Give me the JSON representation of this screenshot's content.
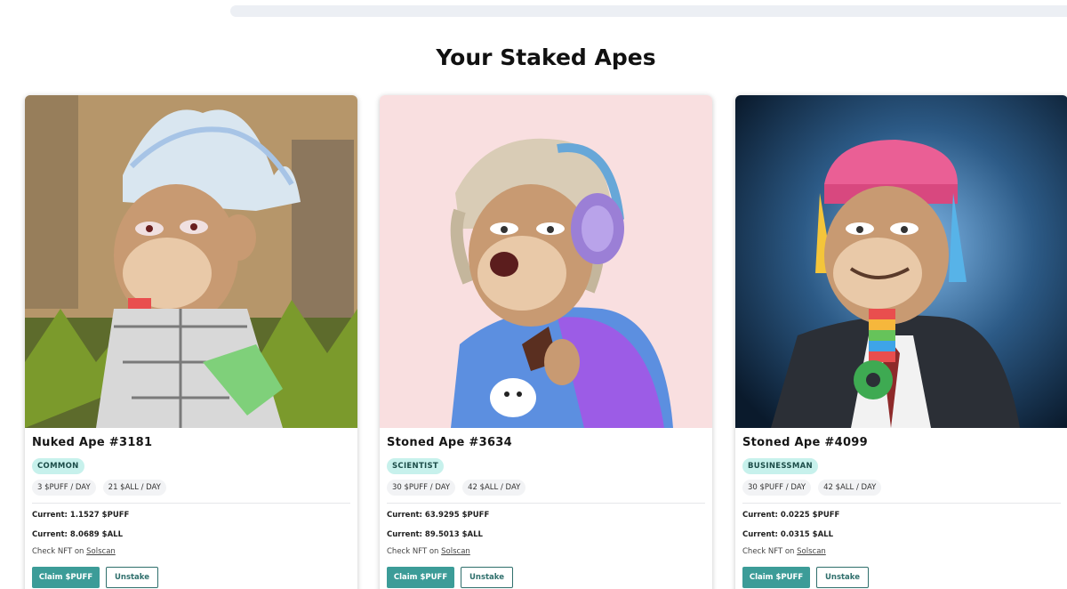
{
  "section_title": "Your Staked Apes",
  "labels": {
    "current_prefix": "Current:",
    "check_prefix": "Check NFT on",
    "check_link": "Solscan",
    "claim_button": "Claim $PUFF",
    "unstake_button": "Unstake"
  },
  "cards": [
    {
      "name": "Nuked Ape #3181",
      "trait": "COMMON",
      "rate_puff": "3 $PUFF / DAY",
      "rate_all": "21 $ALL / DAY",
      "current_puff": "Current: 1.1527 $PUFF",
      "current_all": "Current: 8.0689 $ALL",
      "background_color": "#b89a6a"
    },
    {
      "name": "Stoned Ape #3634",
      "trait": "SCIENTIST",
      "rate_puff": "30 $PUFF / DAY",
      "rate_all": "42 $ALL / DAY",
      "current_puff": "Current: 63.9295 $PUFF",
      "current_all": "Current: 89.5013 $ALL",
      "background_color": "#f9dfe0"
    },
    {
      "name": "Stoned Ape #4099",
      "trait": "BUSINESSMAN",
      "rate_puff": "30 $PUFF / DAY",
      "rate_all": "42 $ALL / DAY",
      "current_puff": "Current: 0.0225 $PUFF",
      "current_all": "Current: 0.0315 $ALL",
      "background_color": "#12304a"
    }
  ],
  "colors": {
    "accent": "#3c9c98",
    "badge_bg": "#c7f1ec"
  }
}
